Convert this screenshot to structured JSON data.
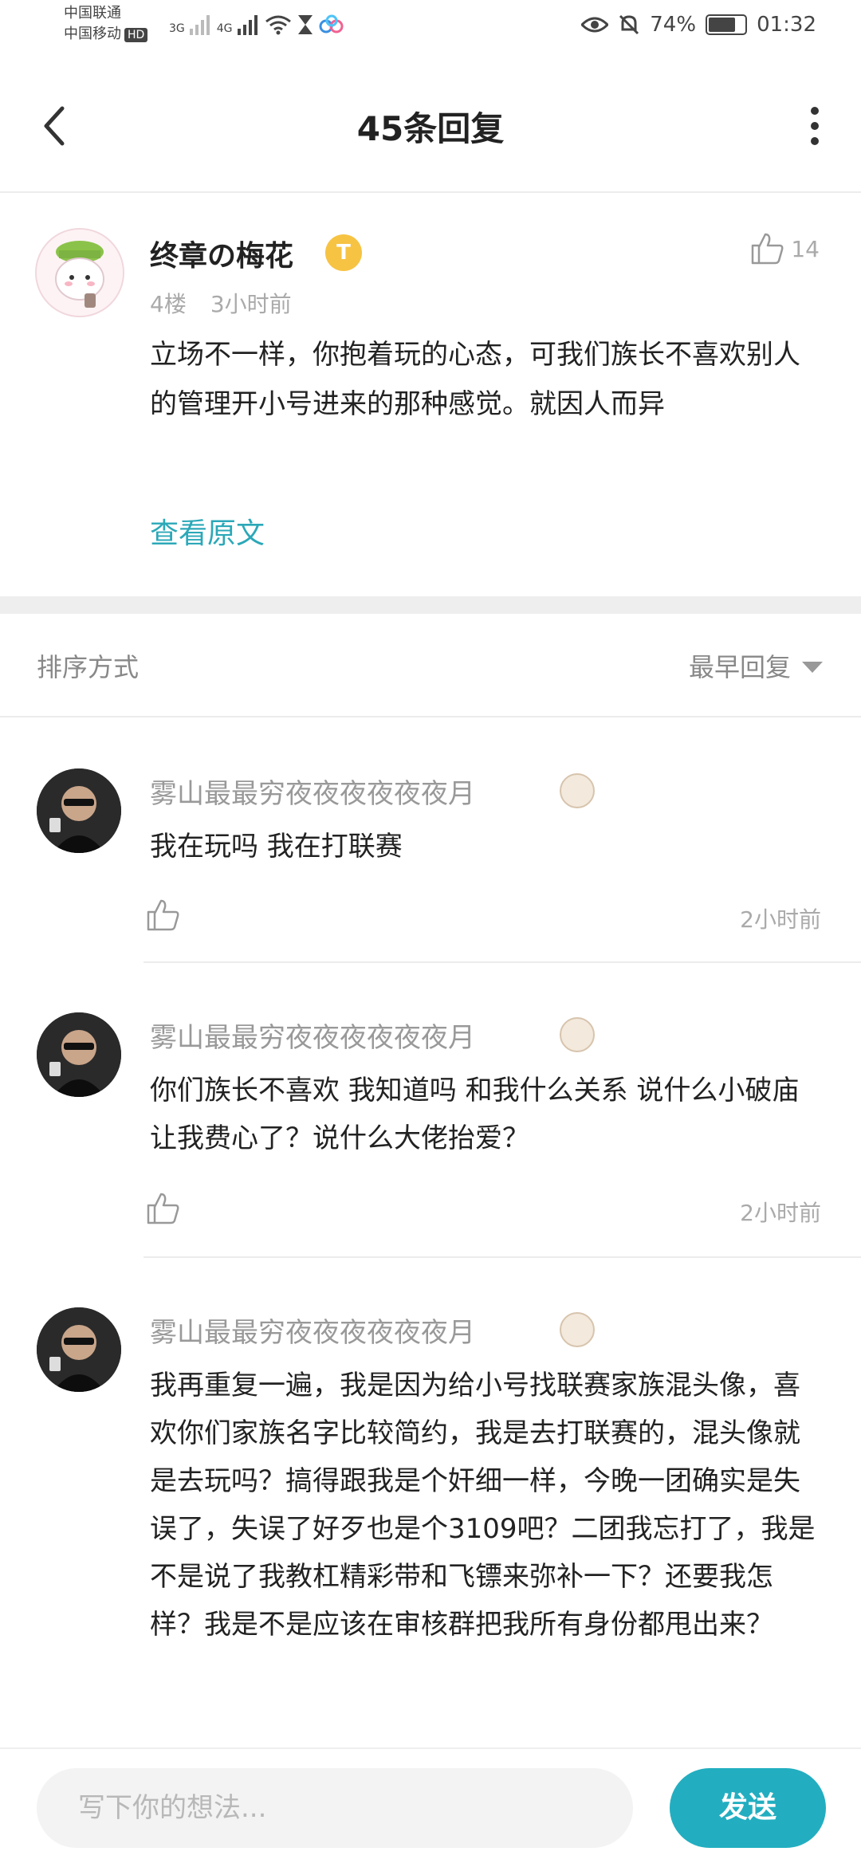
{
  "status_bar": {
    "carrier_1": "中国联通",
    "carrier_2": "中国移动",
    "hd": "HD",
    "net_1": "3G",
    "net_2": "4G",
    "battery": "74%",
    "battery_level": 0.74,
    "time": "01:32"
  },
  "header": {
    "title": "45条回复"
  },
  "main_post": {
    "username": "终章の梅花",
    "level_badge": "T",
    "likes": "14",
    "floor": "4楼",
    "time": "3小时前",
    "text": "立场不一样，你抱着玩的心态，可我们族长不喜欢别人的管理开小号进来的那种感觉。就因人而异",
    "view_original": "查看原文"
  },
  "sort": {
    "label": "排序方式",
    "value": "最早回复"
  },
  "replies": [
    {
      "username": "雾山最最穷夜夜夜夜夜夜月",
      "text": "我在玩吗 我在打联赛",
      "time": "2小时前"
    },
    {
      "username": "雾山最最穷夜夜夜夜夜夜月",
      "text": "你们族长不喜欢 我知道吗 和我什么关系 说什么小破庙让我费心了？说什么大佬抬爱？",
      "time": "2小时前"
    },
    {
      "username": "雾山最最穷夜夜夜夜夜夜月",
      "text": "我再重复一遍，我是因为给小号找联赛家族混头像，喜欢你们家族名字比较简约，我是去打联赛的，混头像就是去玩吗？搞得跟我是个奸细一样，今晚一团确实是失误了，失误了好歹也是个3109吧？二团我忘打了，我是不是说了我教杠精彩带和飞镖来弥补一下？还要我怎样？我是不是应该在审核群把我所有身份都甩出来？"
    }
  ],
  "composer": {
    "placeholder": "写下你的想法...",
    "send_label": "发送"
  }
}
